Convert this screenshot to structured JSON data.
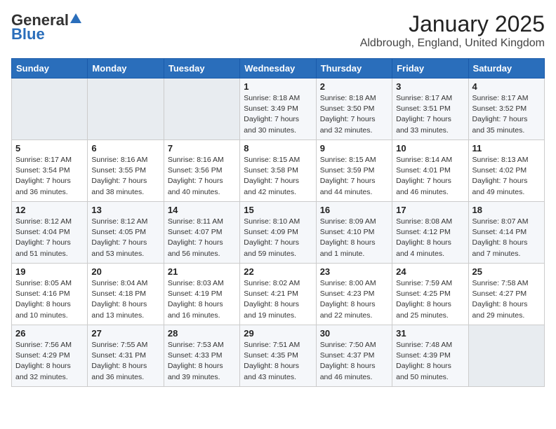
{
  "header": {
    "logo_general": "General",
    "logo_blue": "Blue",
    "month_title": "January 2025",
    "location": "Aldbrough, England, United Kingdom"
  },
  "weekdays": [
    "Sunday",
    "Monday",
    "Tuesday",
    "Wednesday",
    "Thursday",
    "Friday",
    "Saturday"
  ],
  "weeks": [
    [
      {
        "day": "",
        "info": ""
      },
      {
        "day": "",
        "info": ""
      },
      {
        "day": "",
        "info": ""
      },
      {
        "day": "1",
        "info": "Sunrise: 8:18 AM\nSunset: 3:49 PM\nDaylight: 7 hours\nand 30 minutes."
      },
      {
        "day": "2",
        "info": "Sunrise: 8:18 AM\nSunset: 3:50 PM\nDaylight: 7 hours\nand 32 minutes."
      },
      {
        "day": "3",
        "info": "Sunrise: 8:17 AM\nSunset: 3:51 PM\nDaylight: 7 hours\nand 33 minutes."
      },
      {
        "day": "4",
        "info": "Sunrise: 8:17 AM\nSunset: 3:52 PM\nDaylight: 7 hours\nand 35 minutes."
      }
    ],
    [
      {
        "day": "5",
        "info": "Sunrise: 8:17 AM\nSunset: 3:54 PM\nDaylight: 7 hours\nand 36 minutes."
      },
      {
        "day": "6",
        "info": "Sunrise: 8:16 AM\nSunset: 3:55 PM\nDaylight: 7 hours\nand 38 minutes."
      },
      {
        "day": "7",
        "info": "Sunrise: 8:16 AM\nSunset: 3:56 PM\nDaylight: 7 hours\nand 40 minutes."
      },
      {
        "day": "8",
        "info": "Sunrise: 8:15 AM\nSunset: 3:58 PM\nDaylight: 7 hours\nand 42 minutes."
      },
      {
        "day": "9",
        "info": "Sunrise: 8:15 AM\nSunset: 3:59 PM\nDaylight: 7 hours\nand 44 minutes."
      },
      {
        "day": "10",
        "info": "Sunrise: 8:14 AM\nSunset: 4:01 PM\nDaylight: 7 hours\nand 46 minutes."
      },
      {
        "day": "11",
        "info": "Sunrise: 8:13 AM\nSunset: 4:02 PM\nDaylight: 7 hours\nand 49 minutes."
      }
    ],
    [
      {
        "day": "12",
        "info": "Sunrise: 8:12 AM\nSunset: 4:04 PM\nDaylight: 7 hours\nand 51 minutes."
      },
      {
        "day": "13",
        "info": "Sunrise: 8:12 AM\nSunset: 4:05 PM\nDaylight: 7 hours\nand 53 minutes."
      },
      {
        "day": "14",
        "info": "Sunrise: 8:11 AM\nSunset: 4:07 PM\nDaylight: 7 hours\nand 56 minutes."
      },
      {
        "day": "15",
        "info": "Sunrise: 8:10 AM\nSunset: 4:09 PM\nDaylight: 7 hours\nand 59 minutes."
      },
      {
        "day": "16",
        "info": "Sunrise: 8:09 AM\nSunset: 4:10 PM\nDaylight: 8 hours\nand 1 minute."
      },
      {
        "day": "17",
        "info": "Sunrise: 8:08 AM\nSunset: 4:12 PM\nDaylight: 8 hours\nand 4 minutes."
      },
      {
        "day": "18",
        "info": "Sunrise: 8:07 AM\nSunset: 4:14 PM\nDaylight: 8 hours\nand 7 minutes."
      }
    ],
    [
      {
        "day": "19",
        "info": "Sunrise: 8:05 AM\nSunset: 4:16 PM\nDaylight: 8 hours\nand 10 minutes."
      },
      {
        "day": "20",
        "info": "Sunrise: 8:04 AM\nSunset: 4:18 PM\nDaylight: 8 hours\nand 13 minutes."
      },
      {
        "day": "21",
        "info": "Sunrise: 8:03 AM\nSunset: 4:19 PM\nDaylight: 8 hours\nand 16 minutes."
      },
      {
        "day": "22",
        "info": "Sunrise: 8:02 AM\nSunset: 4:21 PM\nDaylight: 8 hours\nand 19 minutes."
      },
      {
        "day": "23",
        "info": "Sunrise: 8:00 AM\nSunset: 4:23 PM\nDaylight: 8 hours\nand 22 minutes."
      },
      {
        "day": "24",
        "info": "Sunrise: 7:59 AM\nSunset: 4:25 PM\nDaylight: 8 hours\nand 25 minutes."
      },
      {
        "day": "25",
        "info": "Sunrise: 7:58 AM\nSunset: 4:27 PM\nDaylight: 8 hours\nand 29 minutes."
      }
    ],
    [
      {
        "day": "26",
        "info": "Sunrise: 7:56 AM\nSunset: 4:29 PM\nDaylight: 8 hours\nand 32 minutes."
      },
      {
        "day": "27",
        "info": "Sunrise: 7:55 AM\nSunset: 4:31 PM\nDaylight: 8 hours\nand 36 minutes."
      },
      {
        "day": "28",
        "info": "Sunrise: 7:53 AM\nSunset: 4:33 PM\nDaylight: 8 hours\nand 39 minutes."
      },
      {
        "day": "29",
        "info": "Sunrise: 7:51 AM\nSunset: 4:35 PM\nDaylight: 8 hours\nand 43 minutes."
      },
      {
        "day": "30",
        "info": "Sunrise: 7:50 AM\nSunset: 4:37 PM\nDaylight: 8 hours\nand 46 minutes."
      },
      {
        "day": "31",
        "info": "Sunrise: 7:48 AM\nSunset: 4:39 PM\nDaylight: 8 hours\nand 50 minutes."
      },
      {
        "day": "",
        "info": ""
      }
    ]
  ]
}
